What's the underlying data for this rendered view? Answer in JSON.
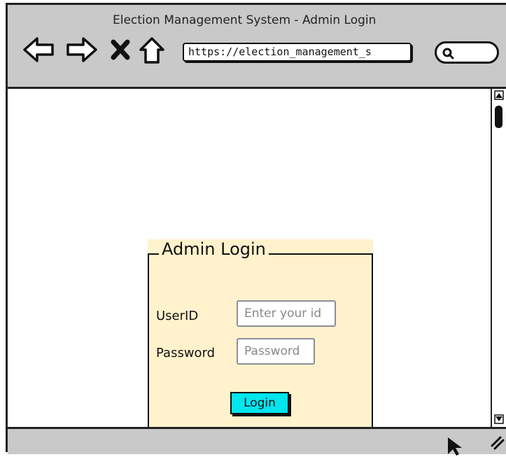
{
  "window": {
    "title": "Election Management System - Admin Login"
  },
  "toolbar": {
    "url": "https://election_management_s",
    "icons": [
      "back-arrow-icon",
      "forward-arrow-icon",
      "close-icon",
      "home-icon",
      "search-icon"
    ]
  },
  "login_panel": {
    "heading": "Admin Login",
    "userid_label": "UserID",
    "userid_placeholder": "Enter your id",
    "password_label": "Password",
    "password_placeholder": "Password",
    "login_button": "Login",
    "background_color": "#fff2cc",
    "button_color": "#00e5ee"
  }
}
